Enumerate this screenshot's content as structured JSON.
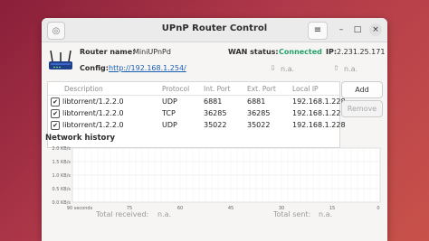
{
  "window": {
    "title": "UPnP Router Control",
    "app_icon": "upnp-app-icon",
    "menu_label": "≡",
    "min_label": "–",
    "max_label": "□",
    "close_label": "×"
  },
  "router": {
    "name_label": "Router name:",
    "name_value": "MiniUPnPd",
    "wan_label": "WAN status:",
    "wan_value": "Connected",
    "ip_label": "IP:",
    "ip_value": "2.231.25.171",
    "config_label": "Config:",
    "config_value": "http://192.168.1.254/",
    "down_rate": "n.a.",
    "up_rate": "n.a."
  },
  "table": {
    "headers": [
      "Description",
      "Protocol",
      "Int. Port",
      "Ext. Port",
      "Local IP"
    ],
    "rows": [
      {
        "checked": "✔",
        "description": "libtorrent/1.2.2.0",
        "protocol": "UDP",
        "int_port": "6881",
        "ext_port": "6881",
        "local_ip": "192.168.1.228"
      },
      {
        "checked": "✔",
        "description": "libtorrent/1.2.2.0",
        "protocol": "TCP",
        "int_port": "36285",
        "ext_port": "36285",
        "local_ip": "192.168.1.228"
      },
      {
        "checked": "✔",
        "description": "libtorrent/1.2.2.0",
        "protocol": "UDP",
        "int_port": "35022",
        "ext_port": "35022",
        "local_ip": "192.168.1.228"
      }
    ]
  },
  "buttons": {
    "add": "Add",
    "remove": "Remove"
  },
  "history": {
    "title": "Network history",
    "y_ticks": [
      "2.0 KB/s",
      "1.5 KB/s",
      "1.0 KB/s",
      "0.5 KB/s",
      "0.0 KB/s"
    ],
    "x_ticks": [
      "90 seconds",
      "75",
      "60",
      "45",
      "30",
      "15",
      "0"
    ],
    "total_received_label": "Total received:",
    "total_received_value": "n.a.",
    "total_sent_label": "Total sent:",
    "total_sent_value": "n.a."
  }
}
